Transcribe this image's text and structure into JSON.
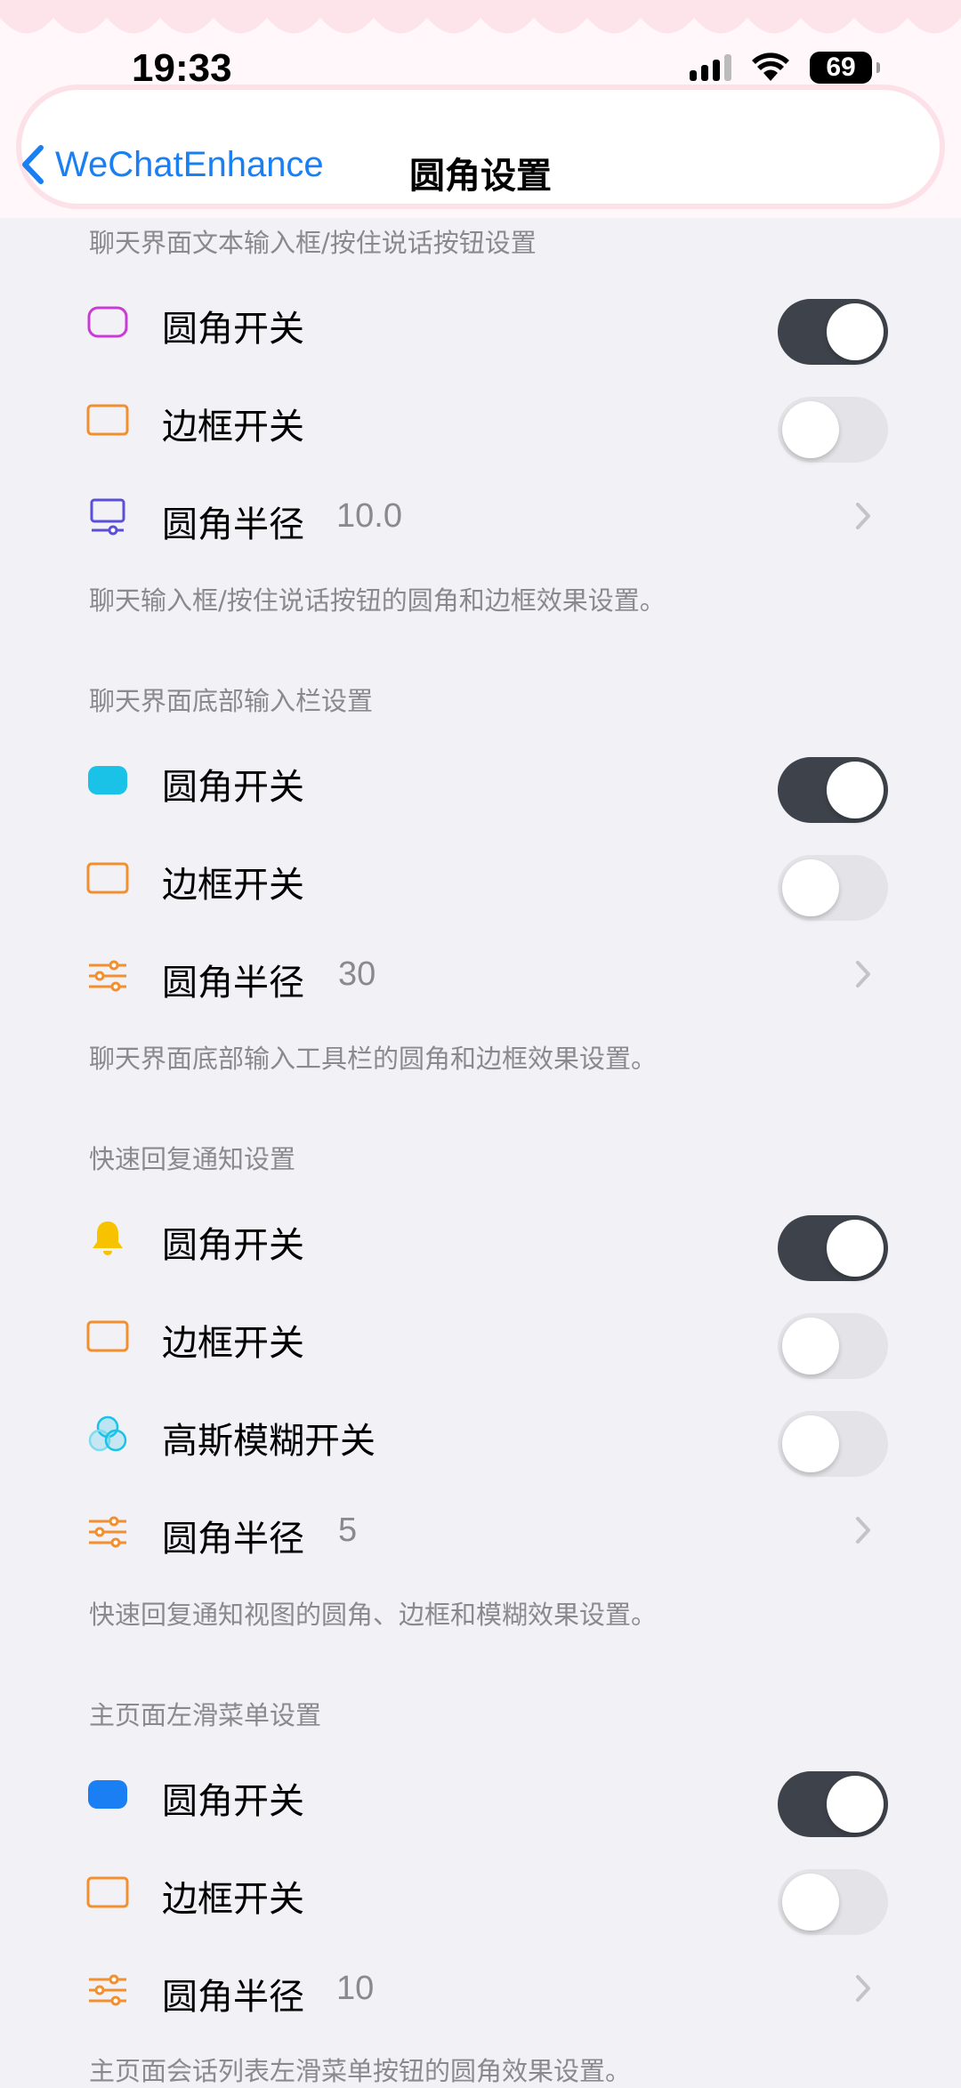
{
  "status_bar": {
    "time": "19:33",
    "battery": "69"
  },
  "nav": {
    "back_label": "WeChatEnhance",
    "title": "圆角设置"
  },
  "colors": {
    "accent": "#1a7ff2",
    "toggle_on": "#3e434b",
    "toggle_off": "#e4e4e8"
  },
  "sections": [
    {
      "header": "聊天界面文本输入框/按住说话按钮设置",
      "footer": "聊天输入框/按住说话按钮的圆角和边框效果设置。",
      "rows": [
        {
          "icon": "rounded-rect-outline-purple-icon",
          "label": "圆角开关",
          "type": "toggle",
          "on": true
        },
        {
          "icon": "rect-outline-orange-icon",
          "label": "边框开关",
          "type": "toggle",
          "on": false
        },
        {
          "icon": "monitor-slider-purple-icon",
          "label": "圆角半径",
          "type": "value",
          "value": "10.0"
        }
      ]
    },
    {
      "header": "聊天界面底部输入栏设置",
      "footer": "聊天界面底部输入工具栏的圆角和边框效果设置。",
      "rows": [
        {
          "icon": "rounded-rect-cyan-icon",
          "label": "圆角开关",
          "type": "toggle",
          "on": true
        },
        {
          "icon": "rect-outline-orange-icon",
          "label": "边框开关",
          "type": "toggle",
          "on": false
        },
        {
          "icon": "sliders-orange-icon",
          "label": "圆角半径",
          "type": "value",
          "value": "30"
        }
      ]
    },
    {
      "header": "快速回复通知设置",
      "footer": "快速回复通知视图的圆角、边框和模糊效果设置。",
      "rows": [
        {
          "icon": "bell-yellow-icon",
          "label": "圆角开关",
          "type": "toggle",
          "on": true
        },
        {
          "icon": "rect-outline-orange-icon",
          "label": "边框开关",
          "type": "toggle",
          "on": false
        },
        {
          "icon": "blur-circles-cyan-icon",
          "label": "高斯模糊开关",
          "type": "toggle",
          "on": false
        },
        {
          "icon": "sliders-orange-icon",
          "label": "圆角半径",
          "type": "value",
          "value": "5"
        }
      ]
    },
    {
      "header": "主页面左滑菜单设置",
      "footer": "主页面会话列表左滑菜单按钮的圆角效果设置。",
      "rows": [
        {
          "icon": "rounded-rect-blue-icon",
          "label": "圆角开关",
          "type": "toggle",
          "on": true
        },
        {
          "icon": "rect-outline-orange-icon",
          "label": "边框开关",
          "type": "toggle",
          "on": false
        },
        {
          "icon": "sliders-orange-icon",
          "label": "圆角半径",
          "type": "value",
          "value": "10"
        }
      ]
    }
  ]
}
